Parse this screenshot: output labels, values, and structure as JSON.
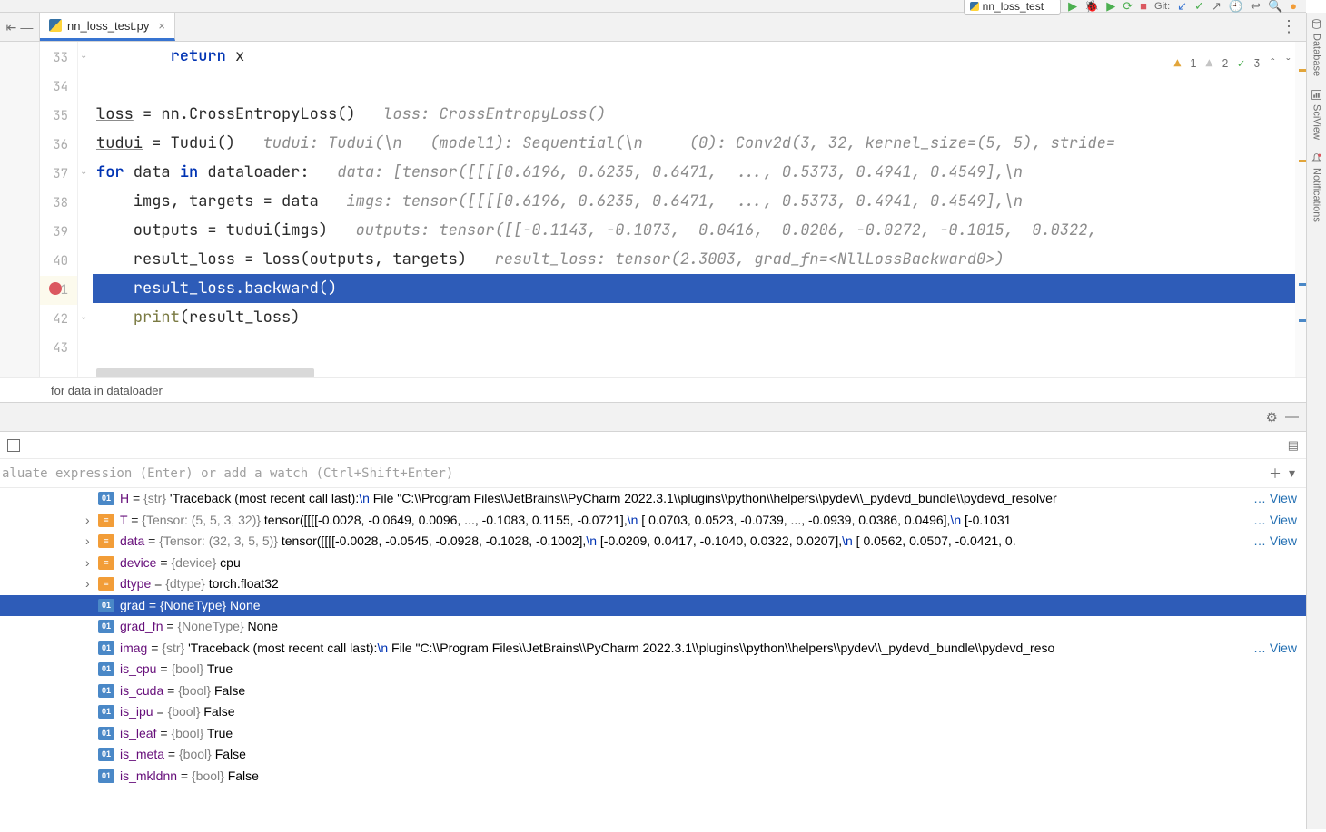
{
  "toolbar": {
    "run_config": "nn_loss_test",
    "git_label": "Git:"
  },
  "tab": {
    "filename": "nn_loss_test.py"
  },
  "right_tools": {
    "database": "Database",
    "sciview": "SciView",
    "notifications": "Notifications"
  },
  "inspections": {
    "warn": "1",
    "weak": "2",
    "ok": "3"
  },
  "gutter": [
    "33",
    "34",
    "35",
    "36",
    "37",
    "38",
    "39",
    "40",
    "41",
    "42",
    "43"
  ],
  "code": {
    "l33": {
      "kw": "return",
      "rest": " x"
    },
    "l35": {
      "lhs": "loss",
      "eq": " = nn.CrossEntropyLoss()",
      "hint": "loss: CrossEntropyLoss()"
    },
    "l36": {
      "lhs": "tudui",
      "eq": " = Tudui()",
      "hint": "tudui: Tudui(\\n   (model1): Sequential(\\n     (0): Conv2d(3, 32, kernel_size=(5, 5), stride="
    },
    "l37": {
      "for": "for",
      "mid": " data ",
      "in": "in",
      "rest": " dataloader:",
      "hint": "data: [tensor([[[[0.6196, 0.6235, 0.6471,  ..., 0.5373, 0.4941, 0.4549],\\n"
    },
    "l38": {
      "txt": "    imgs, targets = data",
      "hint": "imgs: tensor([[[[0.6196, 0.6235, 0.6471,  ..., 0.5373, 0.4941, 0.4549],\\n"
    },
    "l39": {
      "txt": "    outputs = tudui(imgs)",
      "hint": "outputs: tensor([[-0.1143, -0.1073,  0.0416,  0.0206, -0.0272, -0.1015,  0.0322,"
    },
    "l40": {
      "txt": "    result_loss = loss(outputs, targets)",
      "hint": "result_loss: tensor(2.3003, grad_fn=<NllLossBackward0>)"
    },
    "l41": {
      "txt": "    result_loss.backward()"
    },
    "l42": {
      "pr": "print",
      "rest": "(result_loss)"
    }
  },
  "breadcrumb": "for data in dataloader",
  "debug": {
    "expr_placeholder": "aluate expression (Enter) or add a watch (Ctrl+Shift+Enter)"
  },
  "vars": {
    "H": {
      "name": "H",
      "type": "{str}",
      "val_pre": " 'Traceback (most recent call last):",
      "esc": "\\n",
      "val_post": "  File \"C:\\\\Program Files\\\\JetBrains\\\\PyCharm 2022.3.1\\\\plugins\\\\python\\\\helpers\\\\pydev\\\\_pydevd_bundle\\\\pydevd_resolver",
      "view": "… View"
    },
    "T": {
      "name": "T",
      "type": "{Tensor: (5, 5, 3, 32)}",
      "val": " tensor([[[[-0.0028, -0.0649,  0.0096,  ..., -0.1083,  0.1155, -0.0721],",
      "esc": "\\n",
      "tail": "          [ 0.0703,  0.0523, -0.0739,  ..., -0.0939,  0.0386,  0.0496],",
      "esc2": "\\n",
      "tail2": "          [-0.1031",
      "view": "… View"
    },
    "data": {
      "name": "data",
      "type": "{Tensor: (32, 3, 5, 5)}",
      "val": " tensor([[[[-0.0028, -0.0545, -0.0928, -0.1028, -0.1002],",
      "esc": "\\n",
      "tail": "          [-0.0209,  0.0417, -0.1040,  0.0322,  0.0207],",
      "esc2": "\\n",
      "tail2": "          [ 0.0562,  0.0507, -0.0421,  0.",
      "view": "… View"
    },
    "device": {
      "name": "device",
      "type": "{device}",
      "val": " cpu"
    },
    "dtype": {
      "name": "dtype",
      "type": "{dtype}",
      "val": " torch.float32"
    },
    "grad": {
      "name": "grad",
      "type": "{NoneType}",
      "val": " None"
    },
    "grad_fn": {
      "name": "grad_fn",
      "type": "{NoneType}",
      "val": " None"
    },
    "imag": {
      "name": "imag",
      "type": "{str}",
      "val_pre": " 'Traceback (most recent call last):",
      "esc": "\\n",
      "val_post": "  File \"C:\\\\Program Files\\\\JetBrains\\\\PyCharm 2022.3.1\\\\plugins\\\\python\\\\helpers\\\\pydev\\\\_pydevd_bundle\\\\pydevd_reso",
      "view": "… View"
    },
    "is_cpu": {
      "name": "is_cpu",
      "type": "{bool}",
      "val": " True"
    },
    "is_cuda": {
      "name": "is_cuda",
      "type": "{bool}",
      "val": " False"
    },
    "is_ipu": {
      "name": "is_ipu",
      "type": "{bool}",
      "val": " False"
    },
    "is_leaf": {
      "name": "is_leaf",
      "type": "{bool}",
      "val": " True"
    },
    "is_meta": {
      "name": "is_meta",
      "type": "{bool}",
      "val": " False"
    },
    "is_mkldnn": {
      "name": "is_mkldnn",
      "type": "{bool}",
      "val": " False"
    }
  },
  "badges": {
    "field": "01"
  }
}
